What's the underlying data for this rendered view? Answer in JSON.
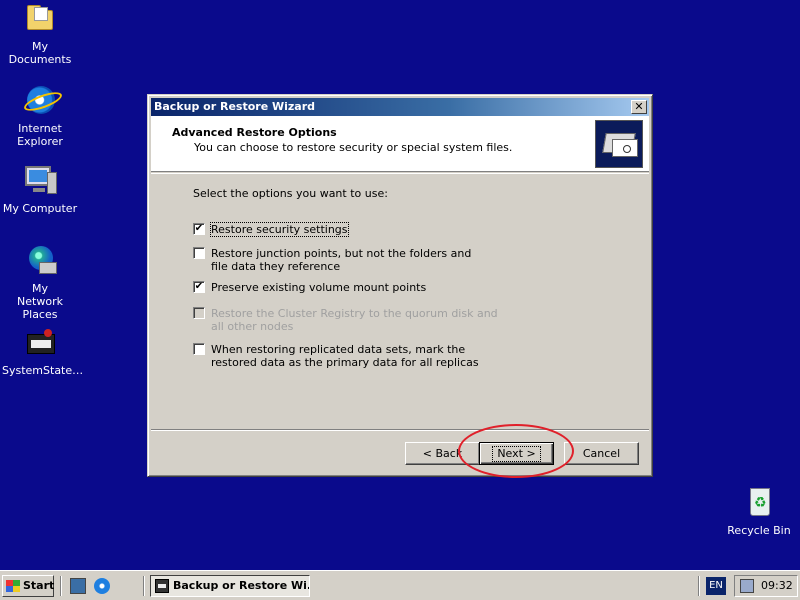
{
  "desktop": {
    "icons": [
      {
        "label": "My Documents"
      },
      {
        "label": "Internet Explorer"
      },
      {
        "label": "My Computer"
      },
      {
        "label": "My Network Places"
      },
      {
        "label": "SystemState…"
      },
      {
        "label": "Recycle Bin"
      }
    ]
  },
  "window": {
    "title": "Backup or Restore Wizard",
    "close_label": "✕",
    "header": {
      "title": "Advanced Restore Options",
      "subtitle": "You can choose to restore security or special system files."
    },
    "prompt": "Select the options you want to use:",
    "options": [
      {
        "label": "Restore security settings",
        "checked": true,
        "enabled": true
      },
      {
        "label": "Restore junction points, but not the folders and file data they reference",
        "checked": false,
        "enabled": true
      },
      {
        "label": "Preserve existing volume mount points",
        "checked": true,
        "enabled": true
      },
      {
        "label": "Restore the Cluster Registry to the quorum disk and all other nodes",
        "checked": false,
        "enabled": false
      },
      {
        "label": "When restoring replicated data sets, mark the restored data as the primary data for all replicas",
        "checked": false,
        "enabled": true
      }
    ],
    "buttons": {
      "back": "< Back",
      "next": "Next >",
      "cancel": "Cancel"
    }
  },
  "taskbar": {
    "start_label": "Start",
    "task_label": "Backup or Restore Wi...",
    "language": "EN",
    "clock": "09:32"
  },
  "colors": {
    "desktop": "#0A0A8C",
    "titlebar_start": "#0A246A",
    "highlight_ring": "#E0202A"
  }
}
